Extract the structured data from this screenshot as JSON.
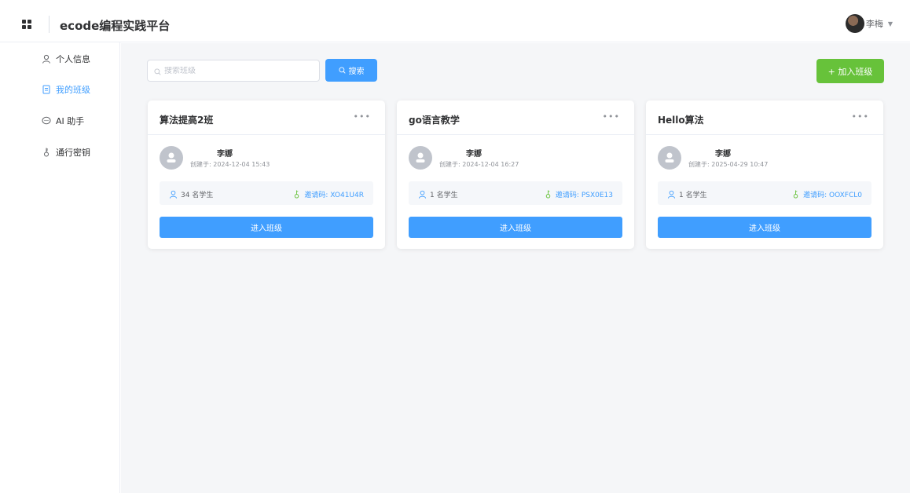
{
  "app": {
    "title": "ecode编程实践平台"
  },
  "user": {
    "name": "李梅"
  },
  "sidebar": {
    "items": [
      {
        "label": "个人信息"
      },
      {
        "label": "我的班级"
      },
      {
        "label": "AI 助手"
      },
      {
        "label": "通行密钥"
      }
    ],
    "active_index": 1
  },
  "toolbar": {
    "search_placeholder": "搜索班级",
    "search_value": "",
    "search_label": "搜索",
    "join_label": "+ 加入班级"
  },
  "colors": {
    "primary": "#409eff",
    "success": "#67c23a",
    "background": "#f5f6f8"
  },
  "classes": [
    {
      "name": "算法提高2班",
      "teacher": "李娜",
      "created": "创建于: 2024-12-04 15:43",
      "students": "34 名学生",
      "invite": "邀请码: XO41U4R",
      "enter_label": "进入班级"
    },
    {
      "name": "go语言教学",
      "teacher": "李娜",
      "created": "创建于: 2024-12-04 16:27",
      "students": "1 名学生",
      "invite": "邀请码: PSX0E13",
      "enter_label": "进入班级"
    },
    {
      "name": "Hello算法",
      "teacher": "李娜",
      "created": "创建于: 2025-04-29 10:47",
      "students": "1 名学生",
      "invite": "邀请码: OOXFCL0",
      "enter_label": "进入班级"
    }
  ]
}
